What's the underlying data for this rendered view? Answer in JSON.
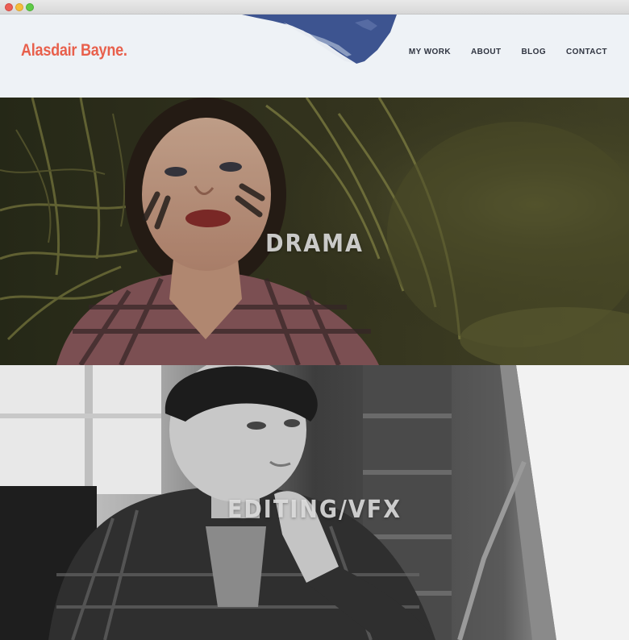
{
  "window": {
    "controls": [
      "close",
      "minimize",
      "zoom"
    ]
  },
  "header": {
    "logo": "Alasdair Bayne.",
    "nav": [
      {
        "label": "MY WORK"
      },
      {
        "label": "ABOUT"
      },
      {
        "label": "BLOG"
      },
      {
        "label": "CONTACT"
      }
    ],
    "decoration": "mountain-peak-illustration"
  },
  "sections": [
    {
      "label": "DRAMA",
      "image": "girl-lying-in-wheat-field-photo"
    },
    {
      "label": "EDITING/VFX",
      "image": "man-at-editing-desk-bw-photo"
    }
  ],
  "colors": {
    "brand": "#e8604c",
    "nav_text": "#2f3440",
    "header_bg": "#eef2f6",
    "mountain": "#3d5490"
  }
}
